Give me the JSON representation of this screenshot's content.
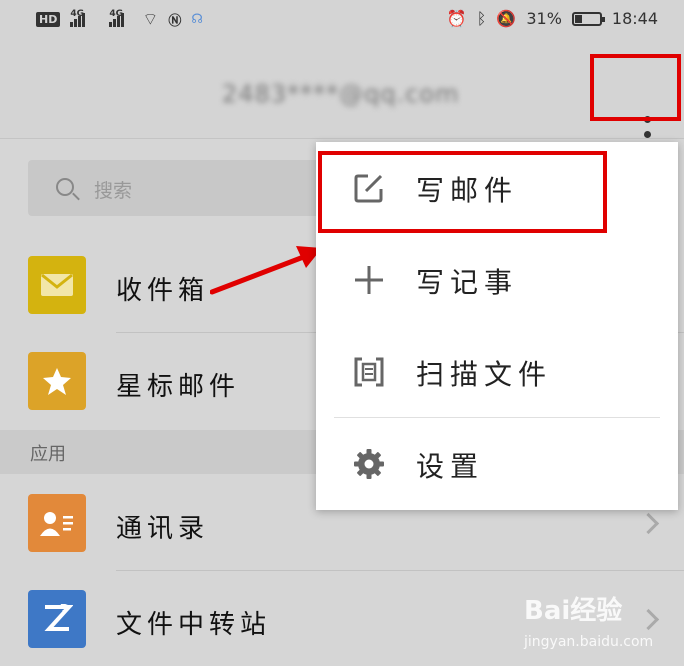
{
  "status": {
    "network_1": "4G",
    "network_2": "4G",
    "battery": "31%",
    "battery_level": 0.31,
    "time": "18:44",
    "hd_label": "HD"
  },
  "header": {
    "account": "2483****@qq.com"
  },
  "search": {
    "placeholder": "搜索"
  },
  "folders": [
    {
      "label": "收件箱",
      "icon": "envelope-icon",
      "color": "#d4b30f"
    },
    {
      "label": "星标邮件",
      "icon": "star-icon",
      "color": "#dca328"
    }
  ],
  "section": {
    "label": "应用"
  },
  "apps": [
    {
      "label": "通讯录",
      "icon": "contact-card-icon",
      "color": "#e2893a"
    },
    {
      "label": "文件中转站",
      "icon": "transfer-icon",
      "color": "#3e78c6"
    }
  ],
  "menu": {
    "items": [
      {
        "label": "写邮件",
        "icon": "compose-icon"
      },
      {
        "label": "写记事",
        "icon": "plus-icon"
      },
      {
        "label": "扫描文件",
        "icon": "scan-icon"
      },
      {
        "label": "设置",
        "icon": "gear-icon"
      }
    ]
  },
  "watermark": {
    "logo": "Bai经验",
    "url": "jingyan.baidu.com"
  },
  "colors": {
    "highlight": "#e00000",
    "menu_bg": "#ffffff",
    "dim_bg": "#d6d6d6"
  }
}
